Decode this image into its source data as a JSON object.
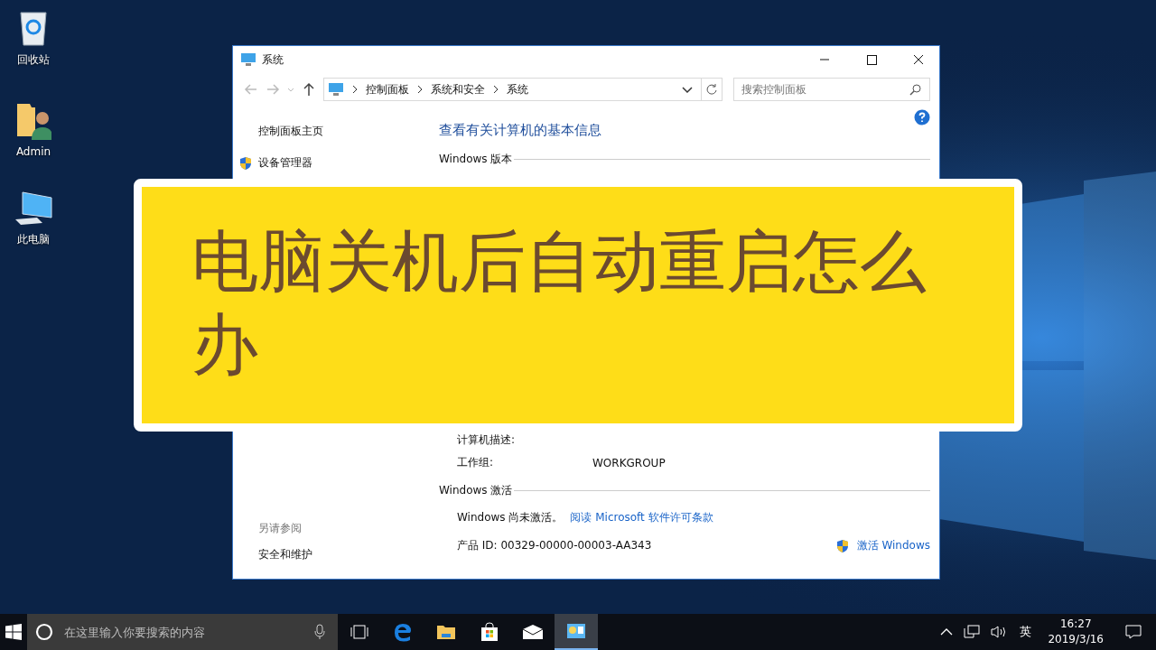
{
  "desktop_icons": [
    {
      "label": "回收站",
      "kind": "recycle"
    },
    {
      "label": "Admin",
      "kind": "user"
    },
    {
      "label": "此电脑",
      "kind": "computer"
    }
  ],
  "window": {
    "title": "系统",
    "breadcrumb": [
      "控制面板",
      "系统和安全",
      "系统"
    ],
    "search": {
      "placeholder": "搜索控制面板"
    },
    "sidebar": {
      "home": "控制面板主页",
      "links": [
        "设备管理器"
      ],
      "see_also_heading": "另请参阅",
      "see_also": [
        "安全和维护"
      ]
    },
    "heading": "查看有关计算机的基本信息",
    "edition_heading": "Windows 版本",
    "computer_rows": [
      {
        "label": "计算机描述:"
      },
      {
        "label": "工作组:",
        "value": "WORKGROUP"
      }
    ],
    "activation": {
      "heading": "Windows 激活",
      "status": "Windows 尚未激活。",
      "license_link": "阅读 Microsoft 软件许可条款",
      "product_id": "产品 ID: 00329-00000-00003-AA343",
      "activate_link": "激活 Windows"
    }
  },
  "banner": {
    "text": "电脑关机后自动重启怎么办"
  },
  "taskbar": {
    "search_placeholder": "在这里输入你要搜索的内容",
    "apps": [
      {
        "kind": "task-view",
        "active": false
      },
      {
        "kind": "edge",
        "active": false
      },
      {
        "kind": "explorer",
        "active": false
      },
      {
        "kind": "store",
        "active": false
      },
      {
        "kind": "mail",
        "active": false
      },
      {
        "kind": "control-panel",
        "active": true
      }
    ],
    "tray": {
      "ime": "英",
      "time": "16:27",
      "date": "2019/3/16"
    }
  }
}
